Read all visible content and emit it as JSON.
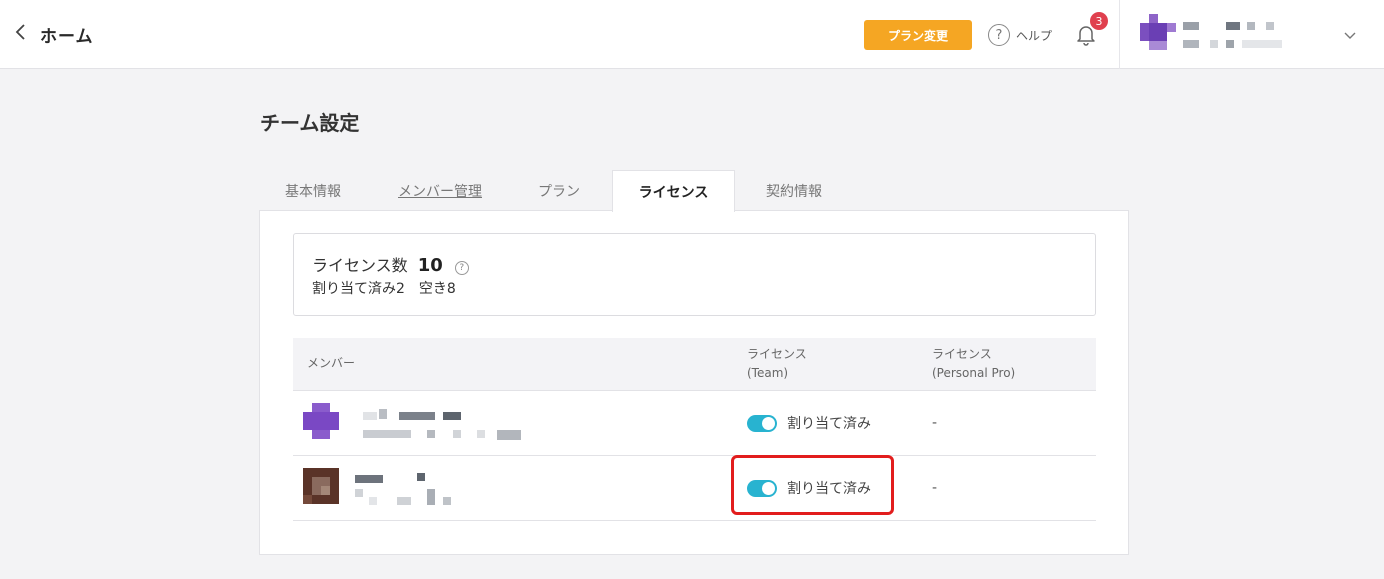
{
  "header": {
    "back_label": "ホーム",
    "plan_button": "プラン変更",
    "help_label": "ヘルプ",
    "help_glyph": "?",
    "notification_count": "3",
    "colors": {
      "plan_button": "#f5a623",
      "badge": "#e0404e"
    }
  },
  "page": {
    "title": "チーム設定",
    "tabs": [
      {
        "label": "基本情報"
      },
      {
        "label": "メンバー管理"
      },
      {
        "label": "プラン"
      },
      {
        "label": "ライセンス",
        "active": true
      },
      {
        "label": "契約情報"
      }
    ]
  },
  "license": {
    "label": "ライセンス数",
    "count": "10",
    "help_glyph": "?",
    "assigned": "割り当て済み2",
    "free": "空き8"
  },
  "table": {
    "headers": {
      "member": "メンバー",
      "team_line1": "ライセンス",
      "team_line2": "(Team)",
      "pro_line1": "ライセンス",
      "pro_line2": "(Personal Pro)"
    },
    "rows": [
      {
        "team_license": "割り当て済み",
        "team_on": true,
        "personal_pro": "-"
      },
      {
        "team_license": "割り当て済み",
        "team_on": true,
        "personal_pro": "-"
      }
    ],
    "toggle_color": "#28b3d0",
    "highlight_color": "#e21d1d"
  }
}
